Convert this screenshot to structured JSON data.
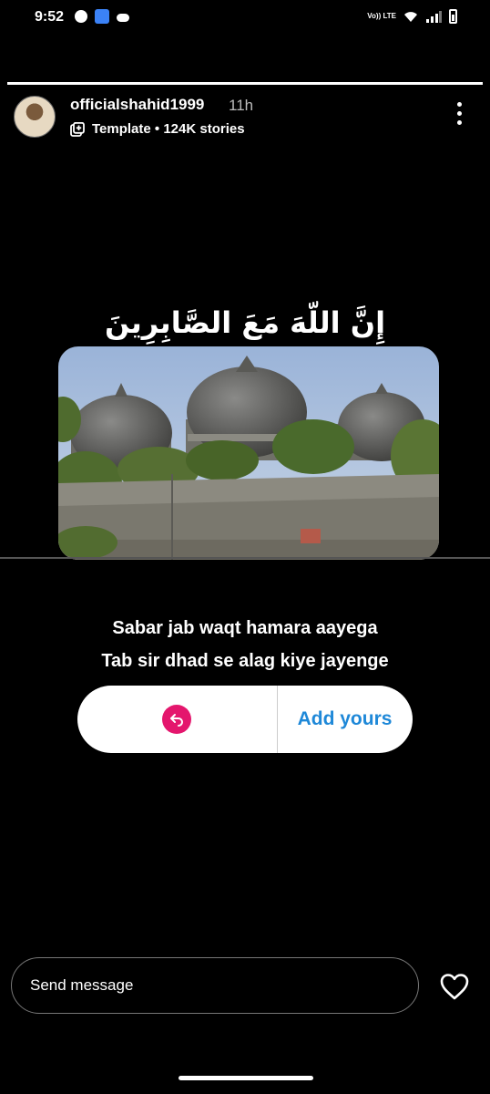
{
  "status_bar": {
    "time": "9:52",
    "network_label": "Vo)) LTE"
  },
  "story": {
    "progress": 1.0,
    "username": "officialshahid1999",
    "time_ago": "11h",
    "template_label": "Template • 124K stories",
    "arabic_text": "إِنَّ اللّهَ مَعَ الصَّابِرِينَ",
    "caption_line1": "Sabar jab waqt hamara aayega",
    "caption_line2": "Tab sir dhad se alag kiye jayenge"
  },
  "add_yours": {
    "label": "Add yours",
    "badge_color": "#e4166d",
    "label_color": "#1e88d8"
  },
  "footer": {
    "message_placeholder": "Send message"
  },
  "icons": {
    "more": "more-vertical-icon",
    "template": "template-add-icon",
    "reply": "reply-arrow-icon",
    "like": "heart-icon"
  }
}
